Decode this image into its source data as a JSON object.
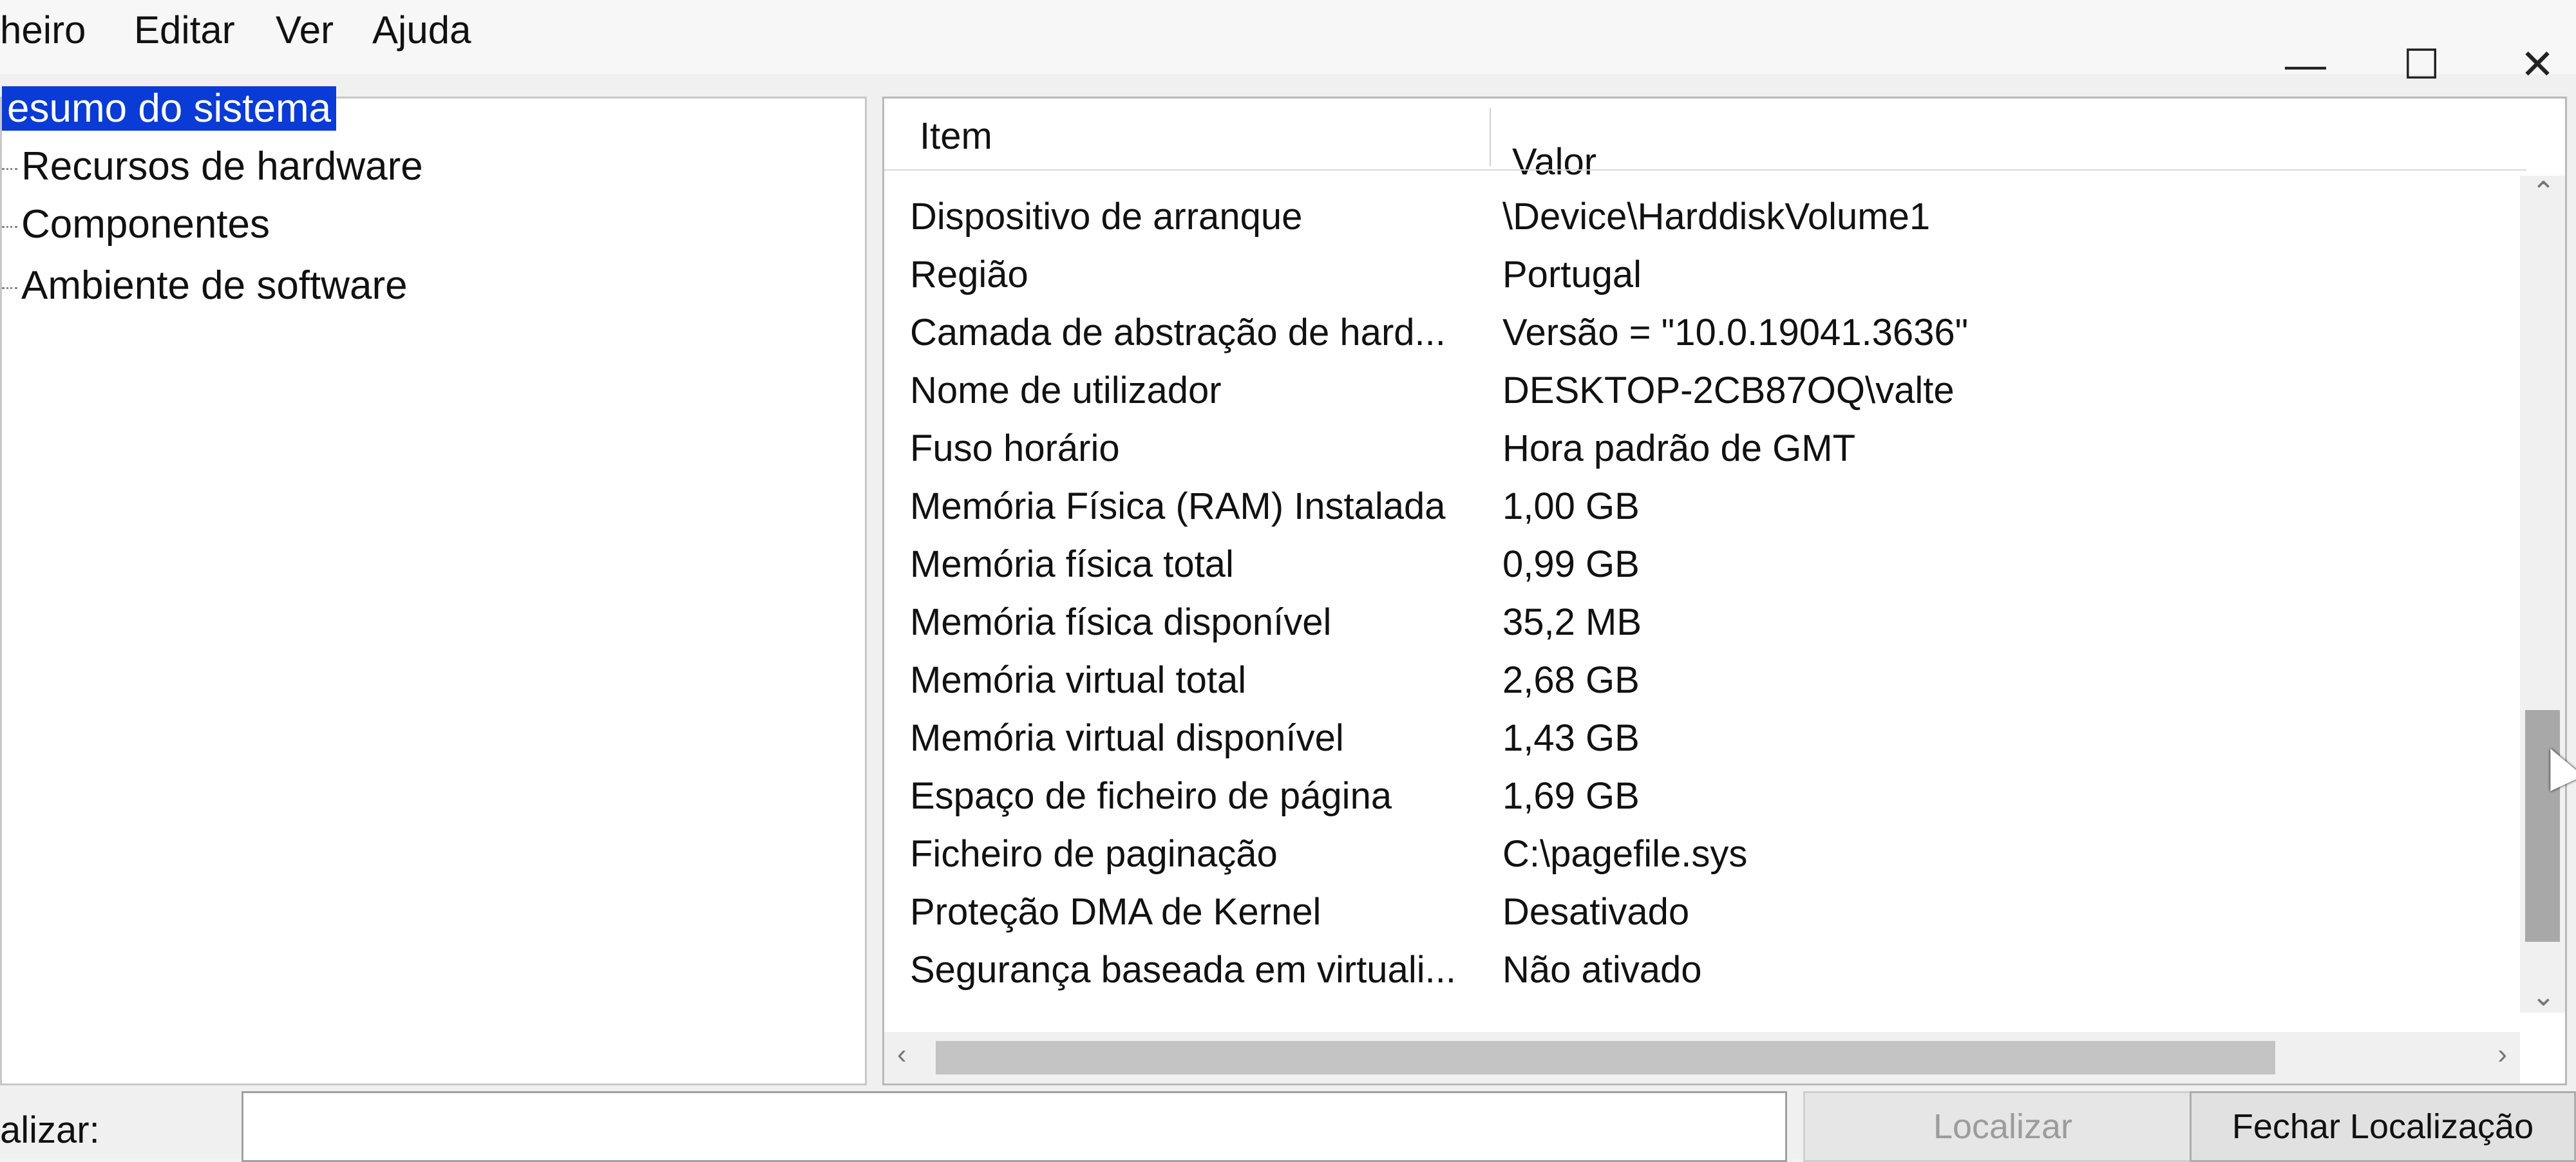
{
  "menu": {
    "items": [
      "heiro",
      "Editar",
      "Ver",
      "Ajuda"
    ]
  },
  "window_controls": {
    "minimize": "—",
    "maximize": "☐",
    "close": "✕"
  },
  "tree": {
    "items": [
      {
        "label": "esumo do sistema",
        "selected": true
      },
      {
        "label": "Recursos de hardware",
        "selected": false
      },
      {
        "label": "Componentes",
        "selected": false
      },
      {
        "label": "Ambiente de software",
        "selected": false
      }
    ]
  },
  "details": {
    "headers": {
      "item": "Item",
      "value": "Valor"
    },
    "rows": [
      {
        "item": "Dispositivo de arranque",
        "value": "\\Device\\HarddiskVolume1"
      },
      {
        "item": "Região",
        "value": "Portugal"
      },
      {
        "item": "Camada de abstração de hard...",
        "value": "Versão = \"10.0.19041.3636\""
      },
      {
        "item": "Nome de utilizador",
        "value": "DESKTOP-2CB87OQ\\valte"
      },
      {
        "item": "Fuso horário",
        "value": "Hora padrão de GMT"
      },
      {
        "item": "Memória Física (RAM) Instalada",
        "value": "1,00 GB"
      },
      {
        "item": "Memória física total",
        "value": "0,99 GB"
      },
      {
        "item": "Memória física disponível",
        "value": "35,2 MB"
      },
      {
        "item": "Memória virtual total",
        "value": "2,68 GB"
      },
      {
        "item": "Memória virtual disponível",
        "value": "1,43 GB"
      },
      {
        "item": "Espaço de ficheiro de página",
        "value": "1,69 GB"
      },
      {
        "item": "Ficheiro de paginação",
        "value": "C:\\pagefile.sys"
      },
      {
        "item": "Proteção DMA de Kernel",
        "value": "Desativado"
      },
      {
        "item": "Segurança baseada em virtuali...",
        "value": "Não ativado"
      }
    ]
  },
  "findbar": {
    "label": "alizar:",
    "input_value": "",
    "find_button": "Localizar",
    "close_find_button": "Fechar Localização"
  },
  "colors": {
    "selection": "#0a3bd6",
    "background": "#f0f0f0"
  },
  "icons": {
    "scroll_up": "chevron-up-icon",
    "scroll_down": "chevron-down-icon",
    "scroll_left": "chevron-left-icon",
    "scroll_right": "chevron-right-icon"
  }
}
